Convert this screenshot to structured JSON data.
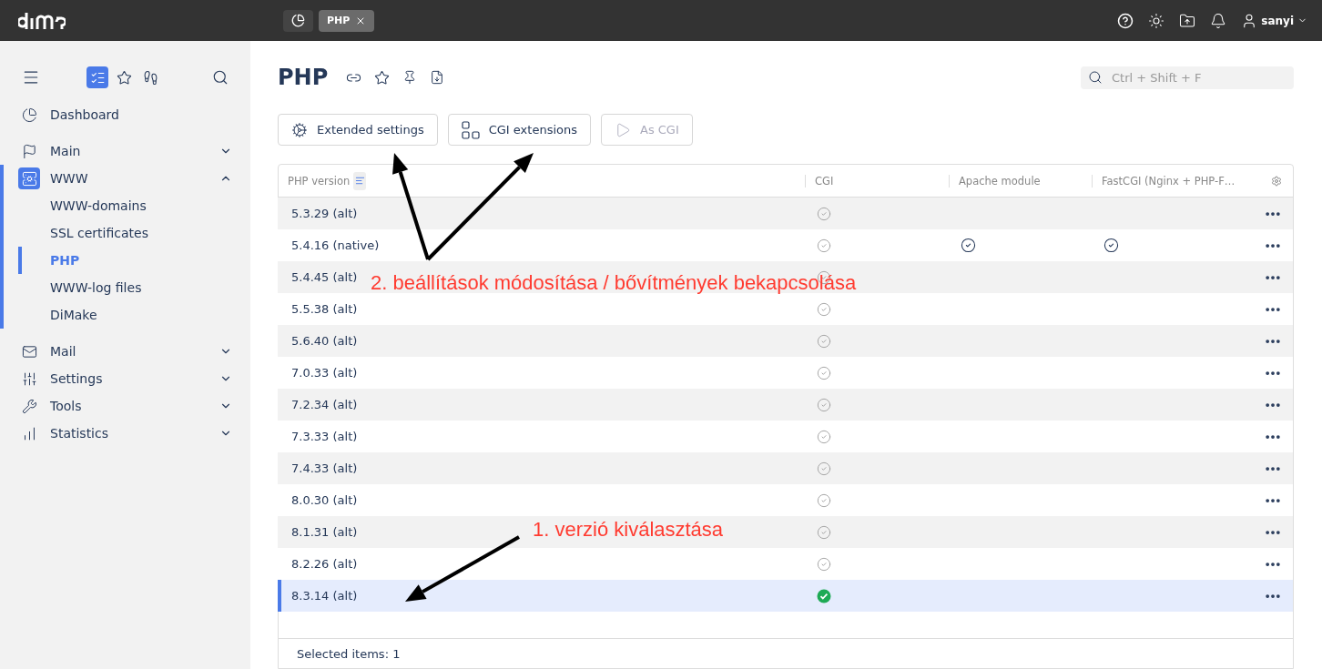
{
  "topbar": {
    "tabs": [
      {
        "kind": "icon",
        "selected": false
      },
      {
        "kind": "text",
        "label": "PHP",
        "selected": true
      }
    ],
    "user": "sanyi"
  },
  "sidebar": {
    "modes": [
      {
        "selected": true
      },
      {
        "selected": false
      },
      {
        "selected": false
      }
    ],
    "items": [
      {
        "label": "Dashboard",
        "selected": false
      },
      {
        "label": "Main",
        "expanded": false,
        "selected": false
      },
      {
        "label": "WWW",
        "expanded": true,
        "selected": true,
        "children": [
          {
            "label": "WWW-domains",
            "selected": false
          },
          {
            "label": "SSL certificates",
            "selected": false
          },
          {
            "label": "PHP",
            "selected": true
          },
          {
            "label": "WWW-log files",
            "selected": false
          },
          {
            "label": "DiMake",
            "selected": false
          }
        ]
      },
      {
        "label": "Mail",
        "expanded": false,
        "selected": false
      },
      {
        "label": "Settings",
        "expanded": false,
        "selected": false
      },
      {
        "label": "Tools",
        "expanded": false,
        "selected": false
      },
      {
        "label": "Statistics",
        "expanded": false,
        "selected": false
      }
    ]
  },
  "page": {
    "title": "PHP",
    "search": {
      "placeholder": "Ctrl + Shift + F"
    },
    "toolbar": [
      {
        "label": "Extended settings",
        "disabled": false
      },
      {
        "label": "CGI extensions",
        "disabled": false
      },
      {
        "label": "As CGI",
        "disabled": true
      }
    ]
  },
  "table": {
    "columns": [
      "PHP version",
      "CGI",
      "Apache module",
      "FastCGI (Nginx + PHP-F…"
    ],
    "rows": [
      {
        "version": "5.3.29 (alt)",
        "cgi": true,
        "apache": false,
        "fastcgi": false,
        "selected": false
      },
      {
        "version": "5.4.16 (native)",
        "cgi": true,
        "apache": true,
        "fastcgi": true,
        "selected": false
      },
      {
        "version": "5.4.45 (alt)",
        "cgi": true,
        "apache": false,
        "fastcgi": false,
        "selected": false
      },
      {
        "version": "5.5.38 (alt)",
        "cgi": true,
        "apache": false,
        "fastcgi": false,
        "selected": false
      },
      {
        "version": "5.6.40 (alt)",
        "cgi": true,
        "apache": false,
        "fastcgi": false,
        "selected": false
      },
      {
        "version": "7.0.33 (alt)",
        "cgi": true,
        "apache": false,
        "fastcgi": false,
        "selected": false
      },
      {
        "version": "7.2.34 (alt)",
        "cgi": true,
        "apache": false,
        "fastcgi": false,
        "selected": false
      },
      {
        "version": "7.3.33 (alt)",
        "cgi": true,
        "apache": false,
        "fastcgi": false,
        "selected": false
      },
      {
        "version": "7.4.33 (alt)",
        "cgi": true,
        "apache": false,
        "fastcgi": false,
        "selected": false
      },
      {
        "version": "8.0.30 (alt)",
        "cgi": true,
        "apache": false,
        "fastcgi": false,
        "selected": false
      },
      {
        "version": "8.1.31 (alt)",
        "cgi": true,
        "apache": false,
        "fastcgi": false,
        "selected": false
      },
      {
        "version": "8.2.26 (alt)",
        "cgi": true,
        "apache": false,
        "fastcgi": false,
        "selected": false
      },
      {
        "version": "8.3.14 (alt)",
        "cgi": true,
        "cgi_active": true,
        "apache": false,
        "fastcgi": false,
        "selected": true
      }
    ],
    "footer": "Selected items: 1"
  },
  "annotations": [
    {
      "text": "2. beállítások módosítása / bővítmények bekapcsolása"
    },
    {
      "text": "1. verzió kiválasztása"
    }
  ]
}
